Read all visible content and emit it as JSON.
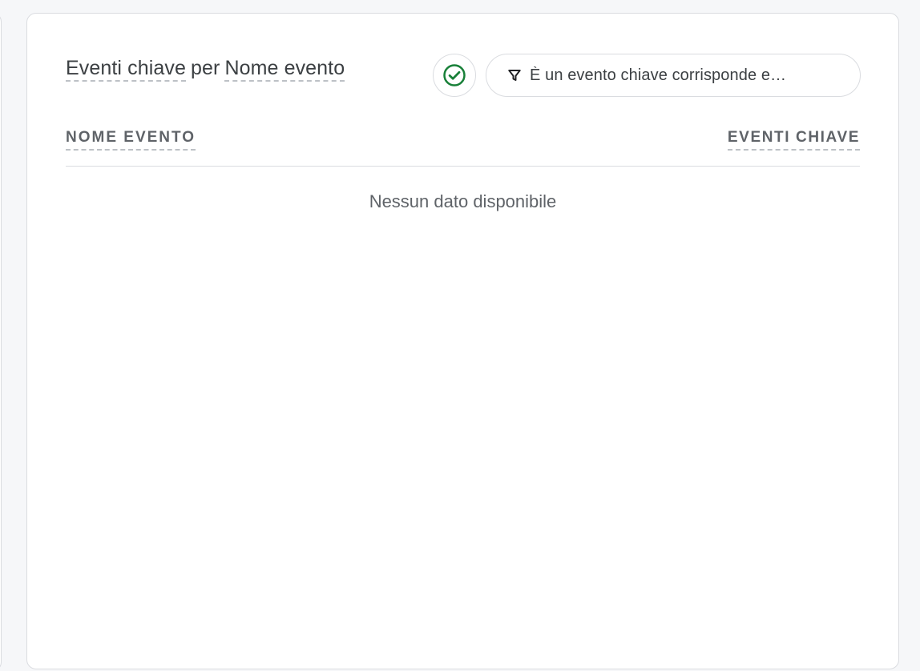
{
  "card": {
    "title": {
      "metric": "Eventi chiave",
      "separator": "per",
      "dimension": "Nome evento"
    },
    "status_icon": "check-circle-icon",
    "filter": {
      "icon": "filter-icon",
      "label": "È un evento chiave corrisponde e…"
    },
    "table": {
      "columns": [
        "NOME EVENTO",
        "EVENTI CHIAVE"
      ],
      "rows": [],
      "empty_message": "Nessun dato disponibile"
    }
  },
  "colors": {
    "accent_green": "#188038",
    "border": "#dadce0",
    "text": "#3c4043",
    "muted_text": "#5f6368"
  }
}
